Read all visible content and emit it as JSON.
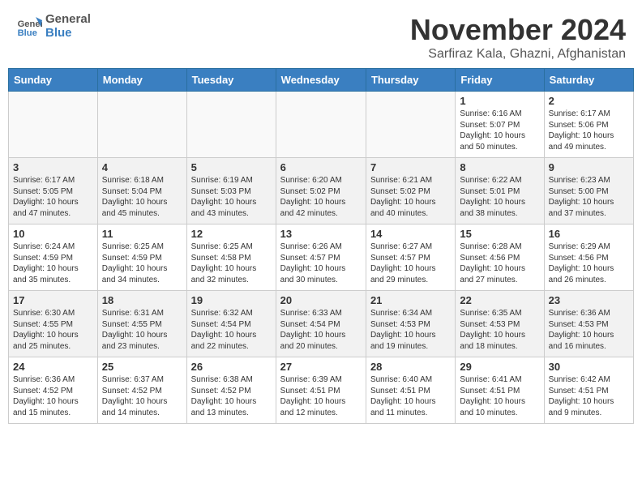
{
  "header": {
    "logo_line1": "General",
    "logo_line2": "Blue",
    "month": "November 2024",
    "location": "Sarfiraz Kala, Ghazni, Afghanistan"
  },
  "weekdays": [
    "Sunday",
    "Monday",
    "Tuesday",
    "Wednesday",
    "Thursday",
    "Friday",
    "Saturday"
  ],
  "weeks": [
    [
      {
        "day": "",
        "info": ""
      },
      {
        "day": "",
        "info": ""
      },
      {
        "day": "",
        "info": ""
      },
      {
        "day": "",
        "info": ""
      },
      {
        "day": "",
        "info": ""
      },
      {
        "day": "1",
        "info": "Sunrise: 6:16 AM\nSunset: 5:07 PM\nDaylight: 10 hours\nand 50 minutes."
      },
      {
        "day": "2",
        "info": "Sunrise: 6:17 AM\nSunset: 5:06 PM\nDaylight: 10 hours\nand 49 minutes."
      }
    ],
    [
      {
        "day": "3",
        "info": "Sunrise: 6:17 AM\nSunset: 5:05 PM\nDaylight: 10 hours\nand 47 minutes."
      },
      {
        "day": "4",
        "info": "Sunrise: 6:18 AM\nSunset: 5:04 PM\nDaylight: 10 hours\nand 45 minutes."
      },
      {
        "day": "5",
        "info": "Sunrise: 6:19 AM\nSunset: 5:03 PM\nDaylight: 10 hours\nand 43 minutes."
      },
      {
        "day": "6",
        "info": "Sunrise: 6:20 AM\nSunset: 5:02 PM\nDaylight: 10 hours\nand 42 minutes."
      },
      {
        "day": "7",
        "info": "Sunrise: 6:21 AM\nSunset: 5:02 PM\nDaylight: 10 hours\nand 40 minutes."
      },
      {
        "day": "8",
        "info": "Sunrise: 6:22 AM\nSunset: 5:01 PM\nDaylight: 10 hours\nand 38 minutes."
      },
      {
        "day": "9",
        "info": "Sunrise: 6:23 AM\nSunset: 5:00 PM\nDaylight: 10 hours\nand 37 minutes."
      }
    ],
    [
      {
        "day": "10",
        "info": "Sunrise: 6:24 AM\nSunset: 4:59 PM\nDaylight: 10 hours\nand 35 minutes."
      },
      {
        "day": "11",
        "info": "Sunrise: 6:25 AM\nSunset: 4:59 PM\nDaylight: 10 hours\nand 34 minutes."
      },
      {
        "day": "12",
        "info": "Sunrise: 6:25 AM\nSunset: 4:58 PM\nDaylight: 10 hours\nand 32 minutes."
      },
      {
        "day": "13",
        "info": "Sunrise: 6:26 AM\nSunset: 4:57 PM\nDaylight: 10 hours\nand 30 minutes."
      },
      {
        "day": "14",
        "info": "Sunrise: 6:27 AM\nSunset: 4:57 PM\nDaylight: 10 hours\nand 29 minutes."
      },
      {
        "day": "15",
        "info": "Sunrise: 6:28 AM\nSunset: 4:56 PM\nDaylight: 10 hours\nand 27 minutes."
      },
      {
        "day": "16",
        "info": "Sunrise: 6:29 AM\nSunset: 4:56 PM\nDaylight: 10 hours\nand 26 minutes."
      }
    ],
    [
      {
        "day": "17",
        "info": "Sunrise: 6:30 AM\nSunset: 4:55 PM\nDaylight: 10 hours\nand 25 minutes."
      },
      {
        "day": "18",
        "info": "Sunrise: 6:31 AM\nSunset: 4:55 PM\nDaylight: 10 hours\nand 23 minutes."
      },
      {
        "day": "19",
        "info": "Sunrise: 6:32 AM\nSunset: 4:54 PM\nDaylight: 10 hours\nand 22 minutes."
      },
      {
        "day": "20",
        "info": "Sunrise: 6:33 AM\nSunset: 4:54 PM\nDaylight: 10 hours\nand 20 minutes."
      },
      {
        "day": "21",
        "info": "Sunrise: 6:34 AM\nSunset: 4:53 PM\nDaylight: 10 hours\nand 19 minutes."
      },
      {
        "day": "22",
        "info": "Sunrise: 6:35 AM\nSunset: 4:53 PM\nDaylight: 10 hours\nand 18 minutes."
      },
      {
        "day": "23",
        "info": "Sunrise: 6:36 AM\nSunset: 4:53 PM\nDaylight: 10 hours\nand 16 minutes."
      }
    ],
    [
      {
        "day": "24",
        "info": "Sunrise: 6:36 AM\nSunset: 4:52 PM\nDaylight: 10 hours\nand 15 minutes."
      },
      {
        "day": "25",
        "info": "Sunrise: 6:37 AM\nSunset: 4:52 PM\nDaylight: 10 hours\nand 14 minutes."
      },
      {
        "day": "26",
        "info": "Sunrise: 6:38 AM\nSunset: 4:52 PM\nDaylight: 10 hours\nand 13 minutes."
      },
      {
        "day": "27",
        "info": "Sunrise: 6:39 AM\nSunset: 4:51 PM\nDaylight: 10 hours\nand 12 minutes."
      },
      {
        "day": "28",
        "info": "Sunrise: 6:40 AM\nSunset: 4:51 PM\nDaylight: 10 hours\nand 11 minutes."
      },
      {
        "day": "29",
        "info": "Sunrise: 6:41 AM\nSunset: 4:51 PM\nDaylight: 10 hours\nand 10 minutes."
      },
      {
        "day": "30",
        "info": "Sunrise: 6:42 AM\nSunset: 4:51 PM\nDaylight: 10 hours\nand 9 minutes."
      }
    ]
  ]
}
